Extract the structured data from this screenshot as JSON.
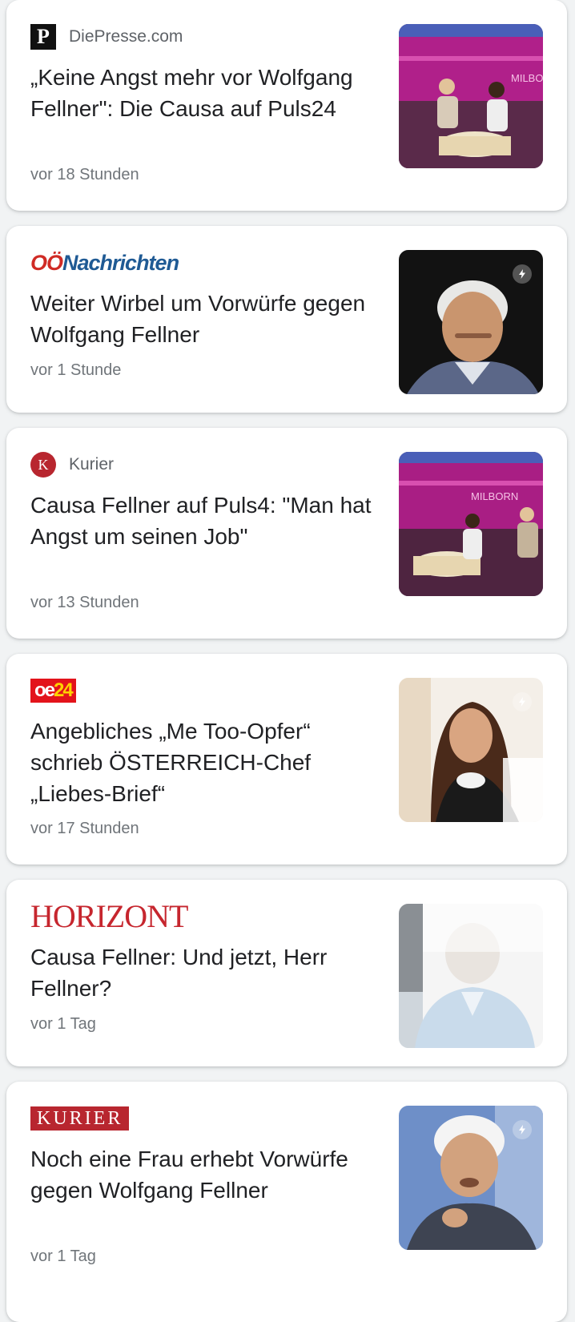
{
  "articles": [
    {
      "source": "DiePresse.com",
      "logo_text": "P",
      "headline": "„Keine Angst mehr vor Wolfgang Fellner\": Die Causa auf Puls24",
      "time": "vor 18 Stunden",
      "amp": false,
      "image": "tv-studio-talk-show"
    },
    {
      "source": "OÖNachrichten",
      "logo_text_a": "OÖ",
      "logo_text_b": "Nachrichten",
      "headline": "Weiter Wirbel um Vorwürfe gegen Wolfgang Fellner",
      "time": "vor 1 Stunde",
      "amp": true,
      "image": "portrait-older-man"
    },
    {
      "source": "Kurier",
      "logo_text": "K",
      "headline": "Causa Fellner auf Puls4: \"Man hat Angst um seinen Job\"",
      "time": "vor 13 Stunden",
      "amp": false,
      "image": "tv-studio-talk-show"
    },
    {
      "source": "oe24",
      "logo_text_a": "oe",
      "logo_text_b": "24",
      "headline": "Angebliches „Me Too-Opfer“ schrieb ÖSTERREICH-Chef „Liebes-Brief“",
      "time": "vor 17 Stunden",
      "amp": true,
      "image": "portrait-woman"
    },
    {
      "source": "HORIZONT",
      "logo_text": "HORIZONT",
      "headline": "Causa Fellner: Und jetzt, Herr Fellner?",
      "time": "vor 1 Tag",
      "amp": false,
      "image": "portrait-man-blurred"
    },
    {
      "source": "KURIER",
      "logo_text": "KURIER",
      "headline": "Noch eine Frau erhebt Vorwürfe gegen Wolfgang Fellner",
      "time": "vor 1 Tag",
      "amp": true,
      "image": "portrait-man-speaking"
    }
  ],
  "colors": {
    "background": "#f1f3f4",
    "card": "#ffffff",
    "headline": "#202124",
    "meta": "#70757a",
    "kurier_red": "#b8262f",
    "oe24_red": "#e3131b",
    "oon_blue": "#1f5a94"
  }
}
